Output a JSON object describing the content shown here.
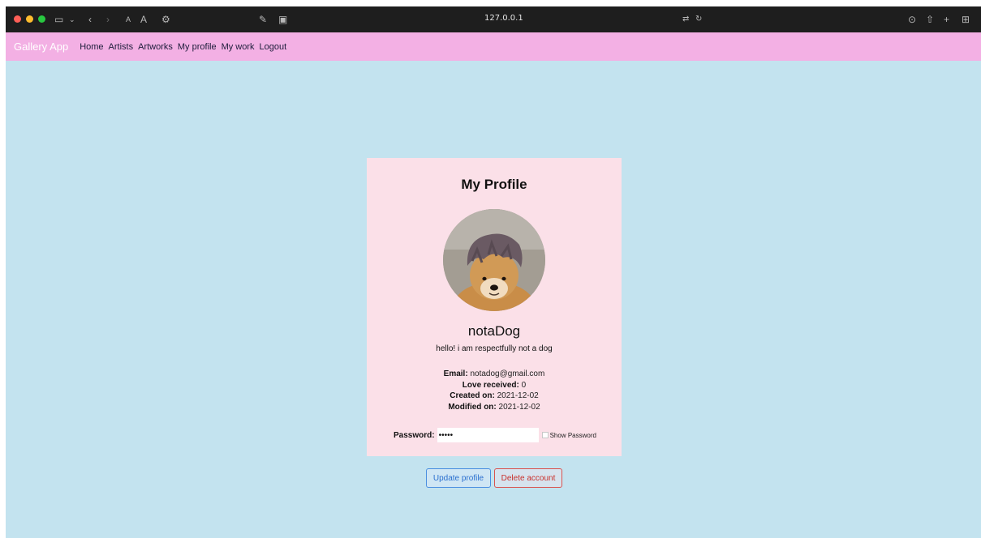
{
  "browser": {
    "url": "127.0.0.1",
    "dot_colors": [
      "#ff5f57",
      "#febc2e",
      "#28c840"
    ]
  },
  "navbar": {
    "brand": "Gallery App",
    "links": [
      "Home",
      "Artists",
      "Artworks",
      "My profile",
      "My work",
      "Logout"
    ]
  },
  "profile": {
    "title": "My Profile",
    "username": "notaDog",
    "bio": "hello! i am respectfully not a dog",
    "fields": [
      {
        "label": "Email:",
        "value": "notadog@gmail.com"
      },
      {
        "label": "Love received:",
        "value": "0"
      },
      {
        "label": "Created on:",
        "value": "2021-12-02"
      },
      {
        "label": "Modified on:",
        "value": "2021-12-02"
      }
    ],
    "password_label": "Password:",
    "password_value": "•••••",
    "show_password_label": "Show Password"
  },
  "actions": {
    "update": "Update profile",
    "delete": "Delete account"
  }
}
